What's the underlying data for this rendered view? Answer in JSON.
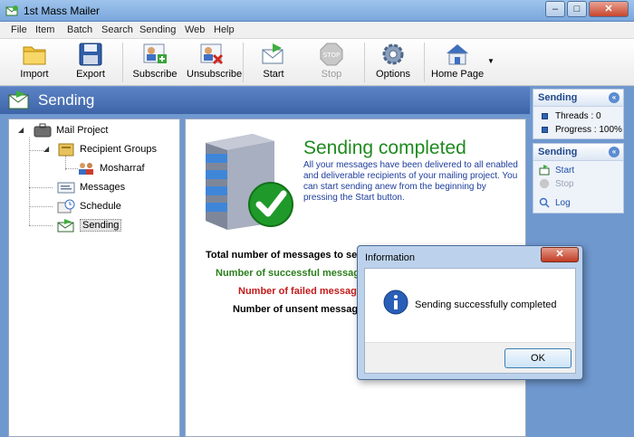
{
  "window": {
    "title": "1st Mass Mailer"
  },
  "menu": [
    "File",
    "Item",
    "Batch",
    "Search",
    "Sending",
    "Web",
    "Help"
  ],
  "toolbar": {
    "import": "Import",
    "export": "Export",
    "subscribe": "Subscribe",
    "unsubscribe": "Unsubscribe",
    "start": "Start",
    "stop": "Stop",
    "options": "Options",
    "home_page": "Home Page"
  },
  "header": {
    "title": "Sending"
  },
  "tree": {
    "mail_project": "Mail Project",
    "recipient_groups": "Recipient Groups",
    "mosharraf": "Mosharraf",
    "messages": "Messages",
    "schedule": "Schedule",
    "sending": "Sending"
  },
  "content": {
    "title": "Sending completed",
    "description": "All your messages have been delivered to all enabled and deliverable recipients of your mailing project. You can start sending anew from the beginning by pressing the Start button.",
    "stat_total": "Total number of messages to send",
    "stat_success": "Number of successful messages",
    "stat_failed": "Number of failed messages",
    "stat_unsent": "Number of unsent messages"
  },
  "side_sending_status": {
    "title": "Sending",
    "threads": "Threads : 0",
    "progress": "Progress : 100%"
  },
  "side_sending_actions": {
    "title": "Sending",
    "start": "Start",
    "stop": "Stop",
    "log": "Log"
  },
  "dialog": {
    "title": "Information",
    "message": "Sending successfully completed",
    "ok": "OK"
  },
  "colors": {
    "title_green": "#1f8a1f",
    "failed_red": "#c41a1a",
    "success_green": "#2a7f1a",
    "header_blue": "#3e64a8"
  }
}
